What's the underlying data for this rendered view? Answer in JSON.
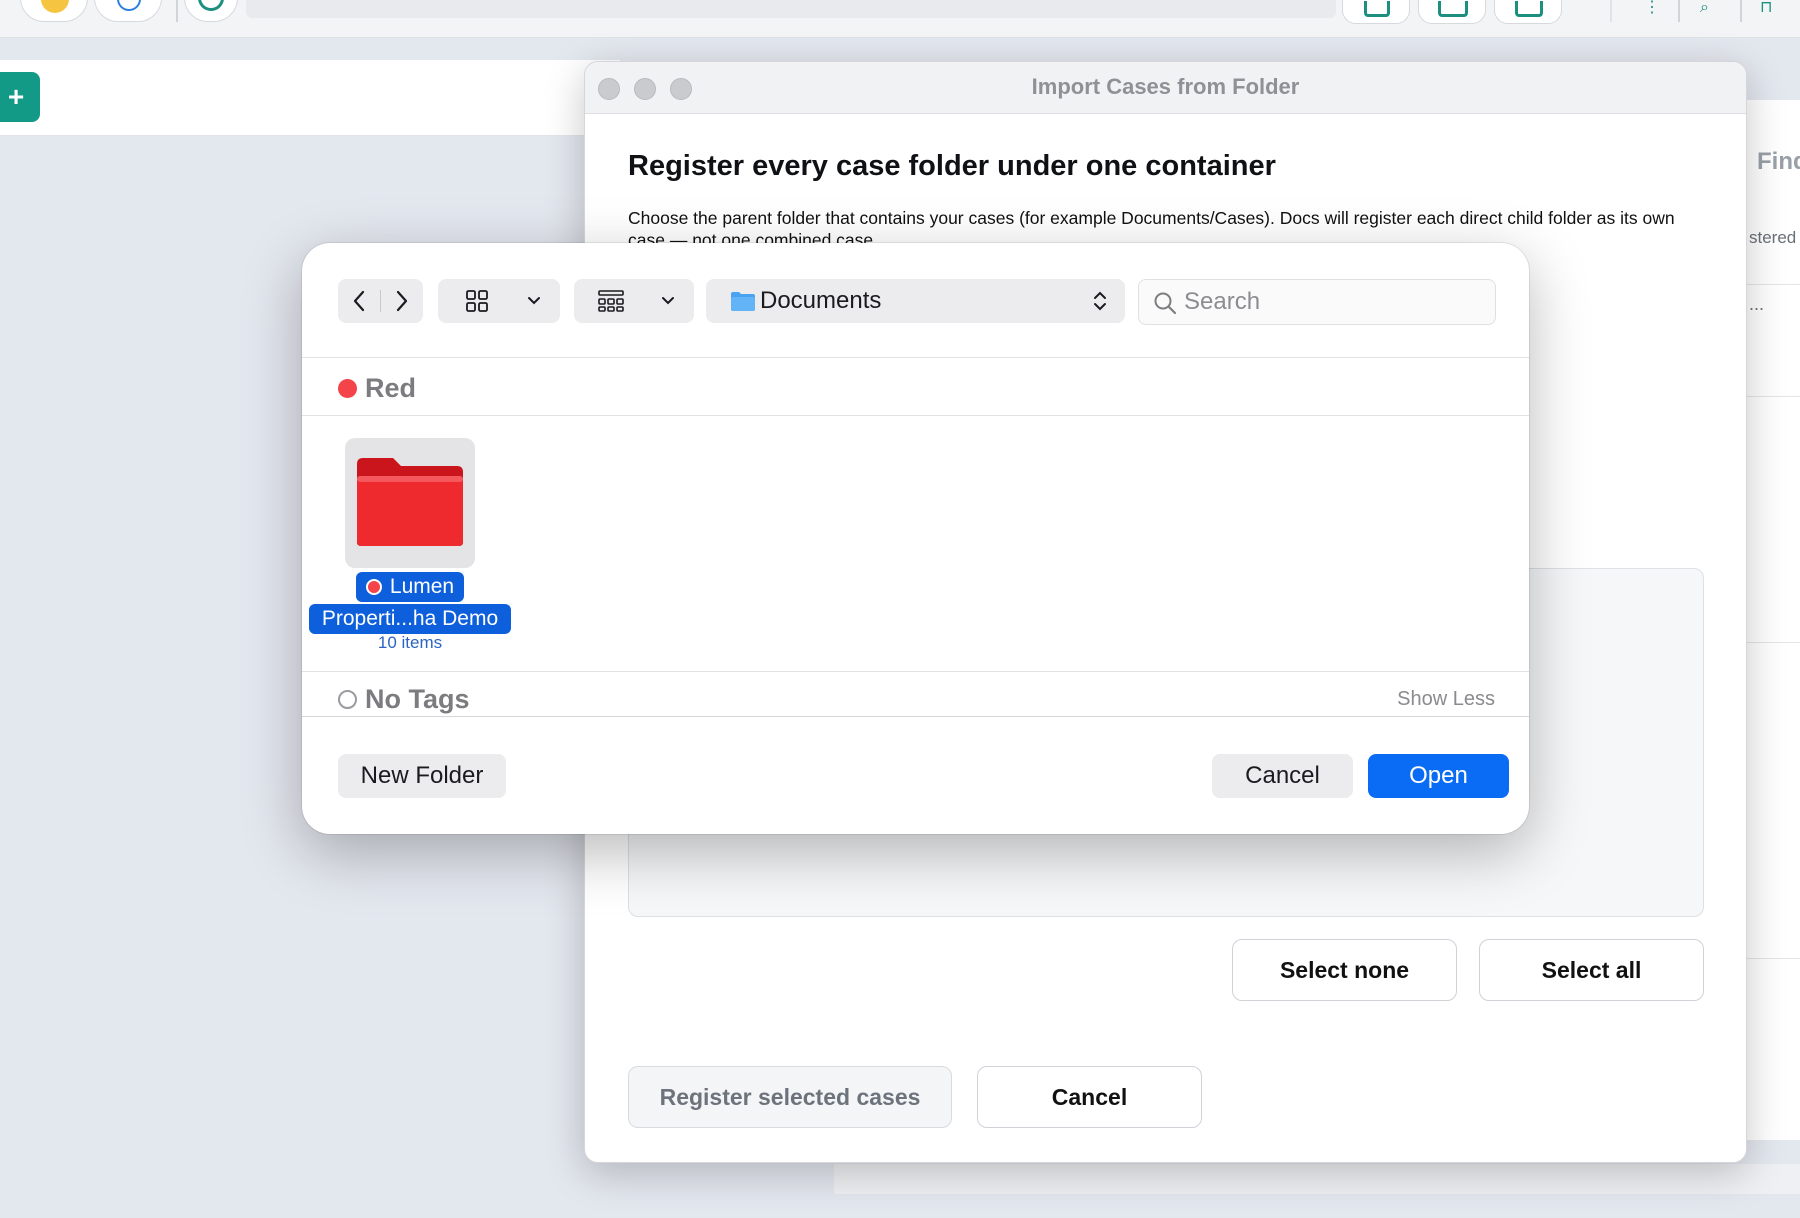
{
  "background": {
    "add_button_label": "+",
    "right_panel": {
      "heading": "Find",
      "status_fragment": "stered",
      "field_fragment": "..."
    },
    "colors": {
      "accent": "#139a86",
      "page_bg": "#e3e7ee"
    }
  },
  "import_dialog": {
    "title": "Import Cases from Folder",
    "heading": "Register every case folder under one container",
    "description": "Choose the parent folder that contains your cases (for example Documents/Cases). Docs will register each direct child folder as its own case — not one combined case.",
    "select_none_label": "Select none",
    "select_all_label": "Select all",
    "register_label": "Register selected cases",
    "cancel_label": "Cancel"
  },
  "file_picker": {
    "location": "Documents",
    "location_icon": "folder-icon",
    "search_placeholder": "Search",
    "groups": [
      {
        "tag": "Red",
        "tag_color": "#f4444a",
        "items": [
          {
            "name_line1": "Lumen",
            "name_line2": "Properti...ha Demo",
            "count": "10 items",
            "icon": "red-folder-icon",
            "selected": true
          }
        ]
      },
      {
        "tag": "No Tags",
        "tag_color": "none",
        "items": []
      }
    ],
    "show_less_label": "Show Less",
    "new_folder_label": "New Folder",
    "cancel_label": "Cancel",
    "open_label": "Open",
    "colors": {
      "primary": "#0a6cf5",
      "selection": "#0d5fdc"
    }
  }
}
